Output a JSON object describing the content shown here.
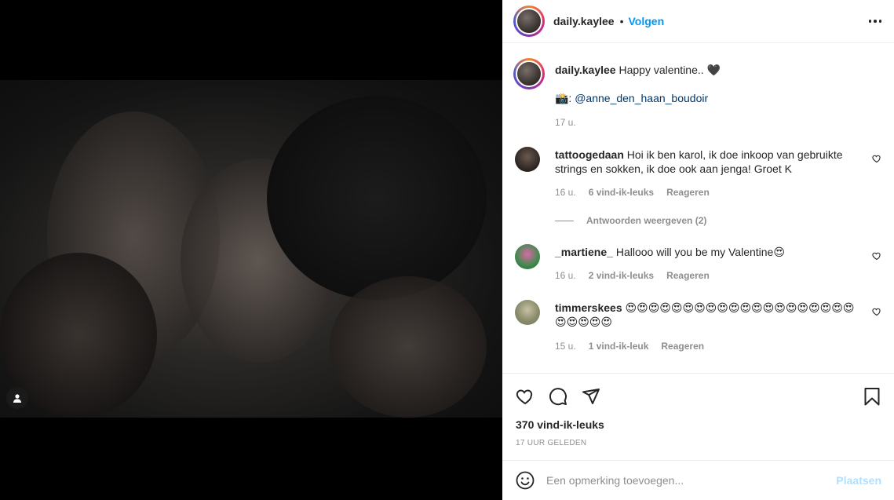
{
  "post": {
    "author": "daily.kaylee",
    "dot": "•",
    "follow_label": "Volgen",
    "caption_text": "Happy valentine.. 🖤",
    "caption_credit_prefix": "📸: ",
    "caption_mention": "@anne_den_haan_boudoir",
    "caption_time": "17 u."
  },
  "comments": [
    {
      "user": "tattoogedaan",
      "text": "Hoi ik ben karol, ik doe inkoop van gebruikte strings en sokken, ik doe ook aan jenga! Groet K",
      "time": "16 u.",
      "likes": "6 vind-ik-leuks",
      "reply": "Reageren"
    },
    {
      "user": "_martiene_",
      "text": "Hallooo will you be my Valentine😍",
      "time": "16 u.",
      "likes": "2 vind-ik-leuks",
      "reply": "Reageren"
    },
    {
      "user": "timmerskees",
      "text": "😍😍😍😍😍😍😍😍😍😍😍😍😍😍😍😍😍😍😍😍😍😍😍😍😍",
      "time": "15 u.",
      "likes": "1 vind-ik-leuk",
      "reply": "Reageren"
    }
  ],
  "replies_toggle": "Antwoorden weergeven (2)",
  "stats": {
    "likes": "370 vind-ik-leuks",
    "time_ago": "17 UUR GELEDEN"
  },
  "comment_box": {
    "placeholder": "Een opmerking toevoegen...",
    "post_label": "Plaatsen"
  },
  "icons": {
    "like": "heart-icon",
    "comment": "comment-bubble-icon",
    "share": "paper-plane-icon",
    "save": "bookmark-icon",
    "emoji": "smiley-icon",
    "more": "more-options-icon",
    "tag": "user-tag-icon"
  },
  "colors": {
    "accent": "#0095f6",
    "post_disabled": "#b2dffc",
    "muted": "#8e8e8e",
    "text": "#262626",
    "mention": "#00376b"
  }
}
